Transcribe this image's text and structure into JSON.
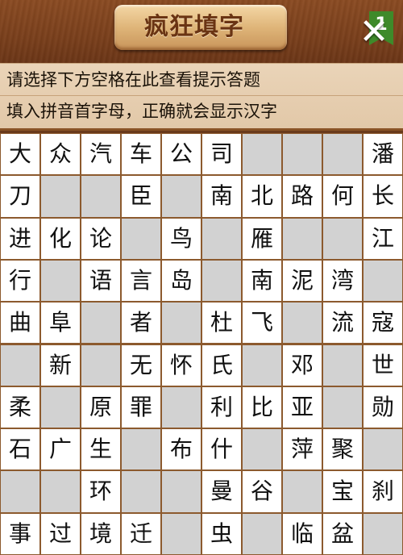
{
  "header": {
    "title": "疯狂填字",
    "level": "1",
    "close_icon": "✕"
  },
  "hints": {
    "line1": "请选择下方空格在此查看提示答题",
    "line2": "填入拼音首字母，正确就会显示汉字"
  },
  "grid": [
    [
      "大",
      "众",
      "汽",
      "车",
      "公",
      "司",
      null,
      null,
      null,
      "潘"
    ],
    [
      "刀",
      null,
      null,
      "臣",
      null,
      "南",
      "北",
      "路",
      "何",
      "长"
    ],
    [
      "进",
      "化",
      "论",
      null,
      "鸟",
      null,
      "雁",
      null,
      null,
      "江"
    ],
    [
      "行",
      null,
      "语",
      "言",
      "岛",
      null,
      "南",
      "泥",
      "湾",
      null
    ],
    [
      "曲",
      "阜",
      null,
      "者",
      null,
      "杜",
      "飞",
      null,
      "流",
      "寇"
    ],
    [
      null,
      "新",
      null,
      "无",
      "怀",
      "氏",
      null,
      "邓",
      null,
      "世"
    ],
    [
      "柔",
      null,
      "原",
      "罪",
      null,
      "利",
      "比",
      "亚",
      null,
      "勋"
    ],
    [
      "石",
      "广",
      "生",
      null,
      "布",
      "什",
      null,
      "萍",
      "聚",
      null
    ],
    [
      null,
      null,
      "环",
      null,
      null,
      "曼",
      "谷",
      null,
      "宝",
      "刹"
    ],
    [
      "事",
      "过",
      "境",
      "迁",
      null,
      "虫",
      null,
      "临",
      "盆",
      null
    ]
  ],
  "cell_colors": {
    "filled": "#ffffff",
    "empty": "#d2d2d2",
    "border": "#8c5a2e"
  }
}
